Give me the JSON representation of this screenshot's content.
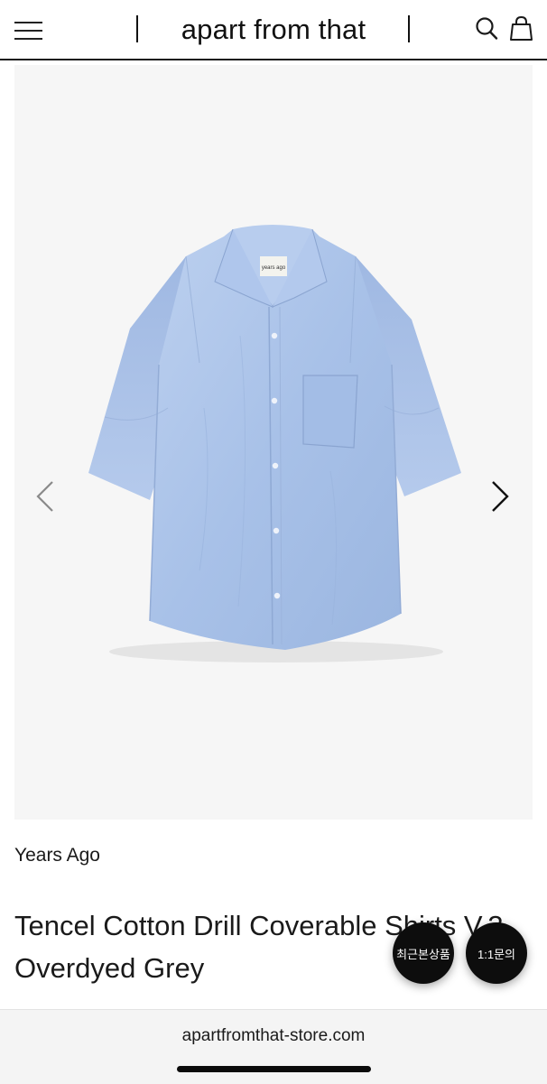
{
  "header": {
    "brand": "apart from that",
    "icons": [
      "menu-icon",
      "search-icon",
      "shopping-bag-icon"
    ]
  },
  "gallery": {
    "image": "blue short-sleeve shirt product photo",
    "shirt_label": "years ago",
    "prev_icon": "chevron-left-icon",
    "next_icon": "chevron-right-icon"
  },
  "product": {
    "brand": "Years Ago",
    "title": "Tencel Cotton Drill Coverable Shirts V.3,",
    "title_line2": "Overdyed Grey"
  },
  "floating": {
    "recent_label": "최근본상품",
    "inquiry_label": "1:1문의"
  },
  "browser": {
    "url": "apartfromthat-store.com"
  },
  "colors": {
    "background": "#ffffff",
    "gallery_bg": "#f6f6f6",
    "shirt": "#a9c3e9",
    "fab": "#0d0d0d"
  }
}
